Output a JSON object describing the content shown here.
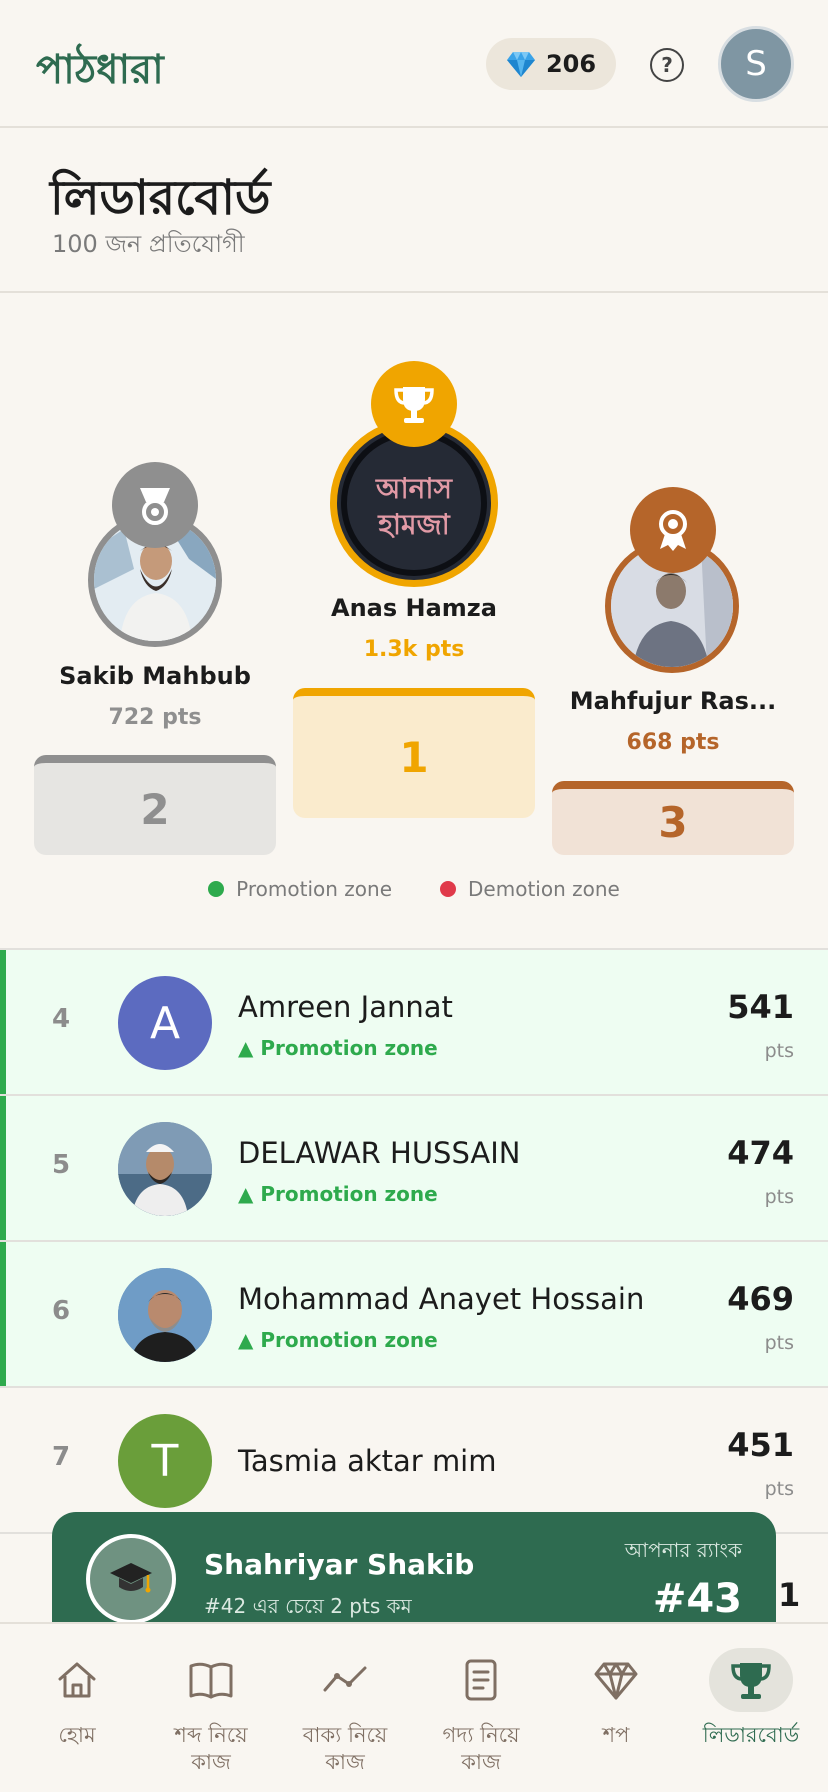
{
  "header": {
    "logo": "পাঠধারা",
    "gems": "206",
    "help_glyph": "?",
    "avatar_initial": "S"
  },
  "title": {
    "heading": "লিডারবোর্ড",
    "subtitle": "100 জন প্রতিযোগী"
  },
  "podium": {
    "first": {
      "name": "Anas Hamza",
      "pts": "1.3k pts",
      "place": "1",
      "avatar_text_top": "আনাস",
      "avatar_text_bottom": "হামজা"
    },
    "second": {
      "name": "Sakib Mahbub",
      "pts": "722 pts",
      "place": "2"
    },
    "third": {
      "name": "Mahfujur Ras...",
      "pts": "668 pts",
      "place": "3"
    }
  },
  "legend": {
    "promotion": "Promotion zone",
    "demotion": "Demotion zone"
  },
  "rows": [
    {
      "rank": "4",
      "initial": "A",
      "name": "Amreen Jannat",
      "zone": "▲ Promotion zone",
      "pts": "541",
      "pts_label": "pts"
    },
    {
      "rank": "5",
      "name": "DELAWAR HUSSAIN",
      "zone": "▲ Promotion zone",
      "pts": "474",
      "pts_label": "pts"
    },
    {
      "rank": "6",
      "name": "Mohammad Anayet Hossain",
      "zone": "▲ Promotion zone",
      "pts": "469",
      "pts_label": "pts"
    },
    {
      "rank": "7",
      "initial": "T",
      "name": "Tasmia aktar mim",
      "pts": "451",
      "pts_label": "pts"
    }
  ],
  "peek_value": "1",
  "my_rank": {
    "name": "Shahriyar Shakib",
    "sub": "#42 এর চেয়ে 2 pts কম",
    "rank_label": "আপনার র‍্যাংক",
    "rank_value": "#43"
  },
  "nav": [
    {
      "label": "হোম",
      "icon": "home-icon"
    },
    {
      "label": "শব্দ নিয়ে\nকাজ",
      "icon": "book-icon"
    },
    {
      "label": "বাক্য নিয়ে\nকাজ",
      "icon": "trend-icon"
    },
    {
      "label": "গদ্য নিয়ে\nকাজ",
      "icon": "document-icon"
    },
    {
      "label": "শপ",
      "icon": "diamond-icon"
    },
    {
      "label": "লিডারবোর্ড",
      "icon": "trophy-icon",
      "active": true
    }
  ],
  "colors": {
    "brand": "#2e6b50",
    "gold": "#f0a500",
    "silver": "#8f8f8f",
    "bronze": "#b5652a",
    "promotion": "#2eaa4d",
    "demotion": "#e03a4a"
  }
}
